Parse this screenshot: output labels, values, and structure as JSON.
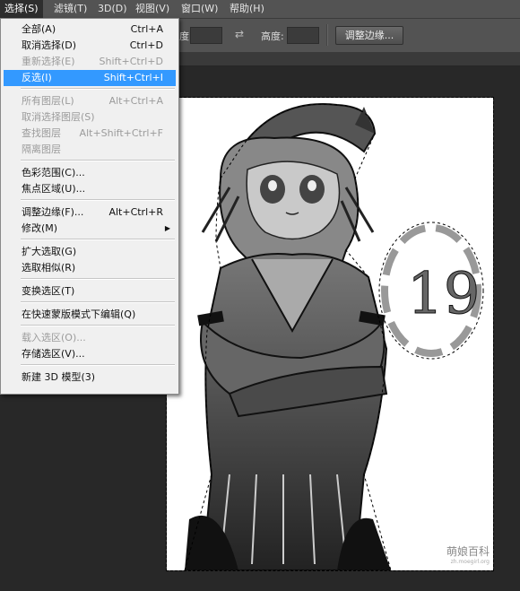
{
  "menubar": {
    "items": [
      {
        "label": "选择(S)"
      },
      {
        "label": "滤镜(T)"
      },
      {
        "label": "3D(D)"
      },
      {
        "label": "视图(V)"
      },
      {
        "label": "窗口(W)"
      },
      {
        "label": "帮助(H)"
      }
    ]
  },
  "options_bar": {
    "width_label_partial": "度:",
    "height_label": "高度:",
    "refine_edge_button": "调整边缘..."
  },
  "select_menu": {
    "items": [
      {
        "label": "全部(A)",
        "shortcut": "Ctrl+A"
      },
      {
        "label": "取消选择(D)",
        "shortcut": "Ctrl+D"
      },
      {
        "label": "重新选择(E)",
        "shortcut": "Shift+Ctrl+D"
      },
      {
        "label": "反选(I)",
        "shortcut": "Shift+Ctrl+I"
      },
      {
        "label": "所有图层(L)",
        "shortcut": "Alt+Ctrl+A"
      },
      {
        "label": "取消选择图层(S)",
        "shortcut": ""
      },
      {
        "label": "查找图层",
        "shortcut": "Alt+Shift+Ctrl+F"
      },
      {
        "label": "隔离图层",
        "shortcut": ""
      },
      {
        "label": "色彩范围(C)...",
        "shortcut": ""
      },
      {
        "label": "焦点区域(U)...",
        "shortcut": ""
      },
      {
        "label": "调整边缘(F)...",
        "shortcut": "Alt+Ctrl+R"
      },
      {
        "label": "修改(M)",
        "shortcut": ""
      },
      {
        "label": "扩大选取(G)",
        "shortcut": ""
      },
      {
        "label": "选取相似(R)",
        "shortcut": ""
      },
      {
        "label": "变换选区(T)",
        "shortcut": ""
      },
      {
        "label": "在快速蒙版模式下编辑(Q)",
        "shortcut": ""
      },
      {
        "label": "载入选区(O)...",
        "shortcut": ""
      },
      {
        "label": "存储选区(V)...",
        "shortcut": ""
      },
      {
        "label": "新建 3D 模型(3)",
        "shortcut": ""
      }
    ]
  },
  "canvas": {
    "watermark_main": "萌娘百科",
    "watermark_sub": "zh.moegirl.org",
    "doodle_text": "19"
  }
}
